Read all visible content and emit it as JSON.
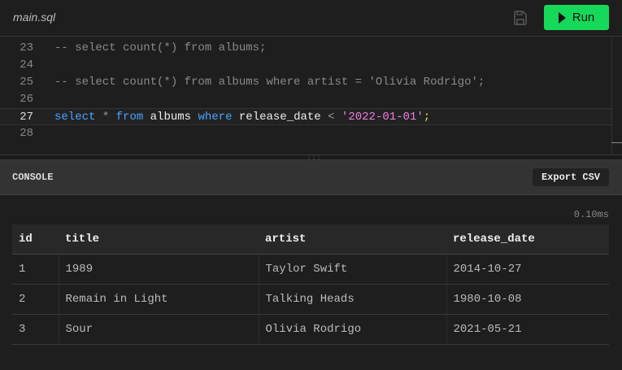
{
  "header": {
    "filename": "main.sql",
    "run_label": "Run"
  },
  "editor": {
    "lines": [
      {
        "n": "23",
        "tokens": [
          {
            "t": "-- select count(*) from albums;",
            "c": "cm"
          }
        ]
      },
      {
        "n": "24",
        "tokens": []
      },
      {
        "n": "25",
        "tokens": [
          {
            "t": "-- select count(*) from albums where artist = 'Olivia Rodrigo';",
            "c": "cm"
          }
        ]
      },
      {
        "n": "26",
        "tokens": []
      },
      {
        "n": "27",
        "active": true,
        "tokens": [
          {
            "t": "select",
            "c": "kw"
          },
          {
            "t": " * ",
            "c": "op"
          },
          {
            "t": "from",
            "c": "kw"
          },
          {
            "t": " albums ",
            "c": "id"
          },
          {
            "t": "where",
            "c": "kw"
          },
          {
            "t": " release_date ",
            "c": "id"
          },
          {
            "t": "<",
            "c": "op"
          },
          {
            "t": " ",
            "c": "id"
          },
          {
            "t": "'2022-01-01'",
            "c": "str"
          },
          {
            "t": ";",
            "c": "semi"
          }
        ]
      },
      {
        "n": "28",
        "tokens": []
      }
    ]
  },
  "console": {
    "title": "CONSOLE",
    "export_label": "Export CSV",
    "timing": "0.10ms",
    "columns": [
      "id",
      "title",
      "artist",
      "release_date"
    ],
    "rows": [
      [
        "1",
        "1989",
        "Taylor Swift",
        "2014-10-27"
      ],
      [
        "2",
        "Remain in Light",
        "Talking Heads",
        "1980-10-08"
      ],
      [
        "3",
        "Sour",
        "Olivia Rodrigo",
        "2021-05-21"
      ]
    ]
  }
}
